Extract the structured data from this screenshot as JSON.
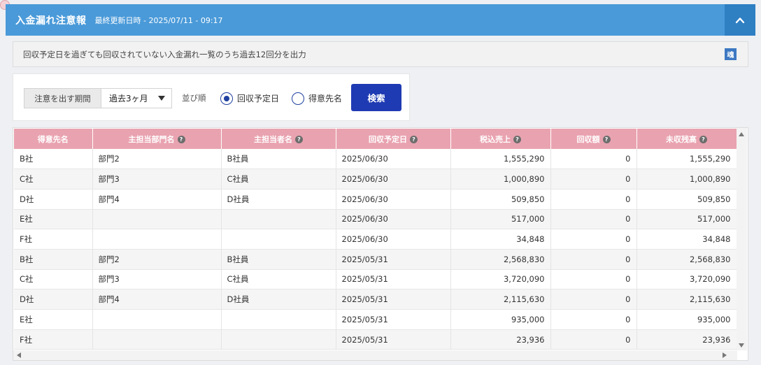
{
  "header": {
    "title": "入金漏れ注意報",
    "updated": "最終更新日時 - 2025/07/11 - 09:17",
    "accent_color": "#4a9ad9"
  },
  "notice": {
    "text": "回収予定日を過ぎても回収されていない入金漏れ一覧のうち過去12回分を出力",
    "icon_text": "魂"
  },
  "filter": {
    "period_label": "注意を出す期間",
    "period_value": "過去3ヶ月",
    "sort_label": "並び順",
    "sort_options": [
      "回収予定日",
      "得意先名"
    ],
    "sort_selected": "回収予定日",
    "search_label": "検索"
  },
  "table": {
    "columns": [
      "得意先名",
      "主担当部門名",
      "主担当者名",
      "回収予定日",
      "税込売上",
      "回収額",
      "未収残高"
    ],
    "help_icon": "?",
    "rows": [
      [
        "B社",
        "部門2",
        "B社員",
        "2025/06/30",
        "1,555,290",
        "0",
        "1,555,290"
      ],
      [
        "C社",
        "部門3",
        "C社員",
        "2025/06/30",
        "1,000,890",
        "0",
        "1,000,890"
      ],
      [
        "D社",
        "部門4",
        "D社員",
        "2025/06/30",
        "509,850",
        "0",
        "509,850"
      ],
      [
        "E社",
        "",
        "",
        "2025/06/30",
        "517,000",
        "0",
        "517,000"
      ],
      [
        "F社",
        "",
        "",
        "2025/06/30",
        "34,848",
        "0",
        "34,848"
      ],
      [
        "B社",
        "部門2",
        "B社員",
        "2025/05/31",
        "2,568,830",
        "0",
        "2,568,830"
      ],
      [
        "C社",
        "部門3",
        "C社員",
        "2025/05/31",
        "3,720,090",
        "0",
        "3,720,090"
      ],
      [
        "D社",
        "部門4",
        "D社員",
        "2025/05/31",
        "2,115,630",
        "0",
        "2,115,630"
      ],
      [
        "E社",
        "",
        "",
        "2025/05/31",
        "935,000",
        "0",
        "935,000"
      ],
      [
        "F社",
        "",
        "",
        "2025/05/31",
        "23,936",
        "0",
        "23,936"
      ]
    ]
  }
}
